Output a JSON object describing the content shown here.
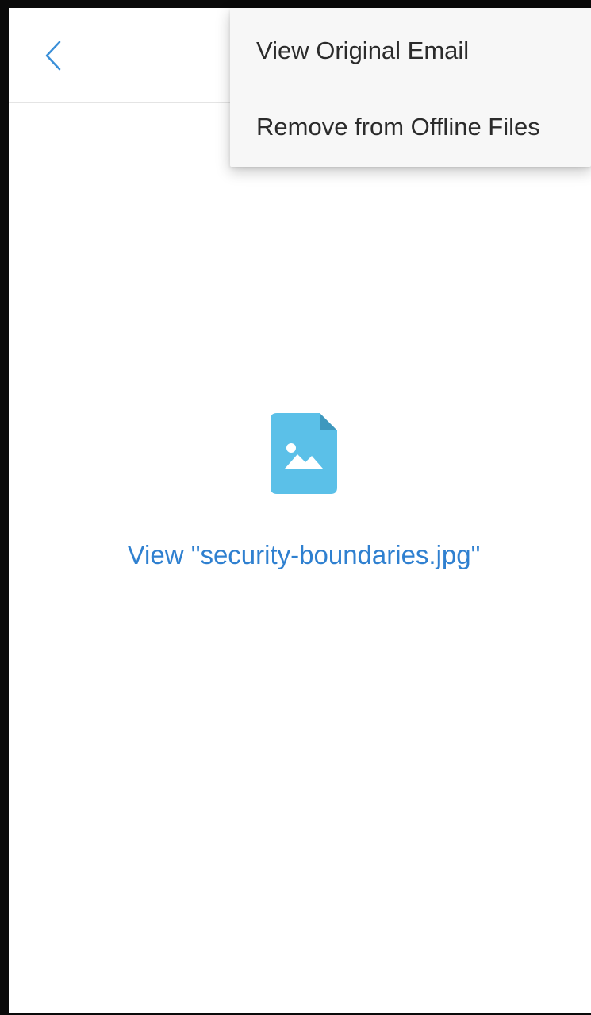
{
  "header": {
    "back_icon": "chevron-left-icon"
  },
  "content": {
    "file_icon": "image-file-icon",
    "view_link_label": "View \"security-boundaries.jpg\""
  },
  "menu": {
    "items": [
      {
        "label": "View Original Email"
      },
      {
        "label": "Remove from Offline Files"
      }
    ]
  },
  "colors": {
    "accent": "#2f80d0",
    "file_icon": "#5bc0e8",
    "file_icon_fold": "#3e98be",
    "menu_background": "#f7f7f7"
  }
}
